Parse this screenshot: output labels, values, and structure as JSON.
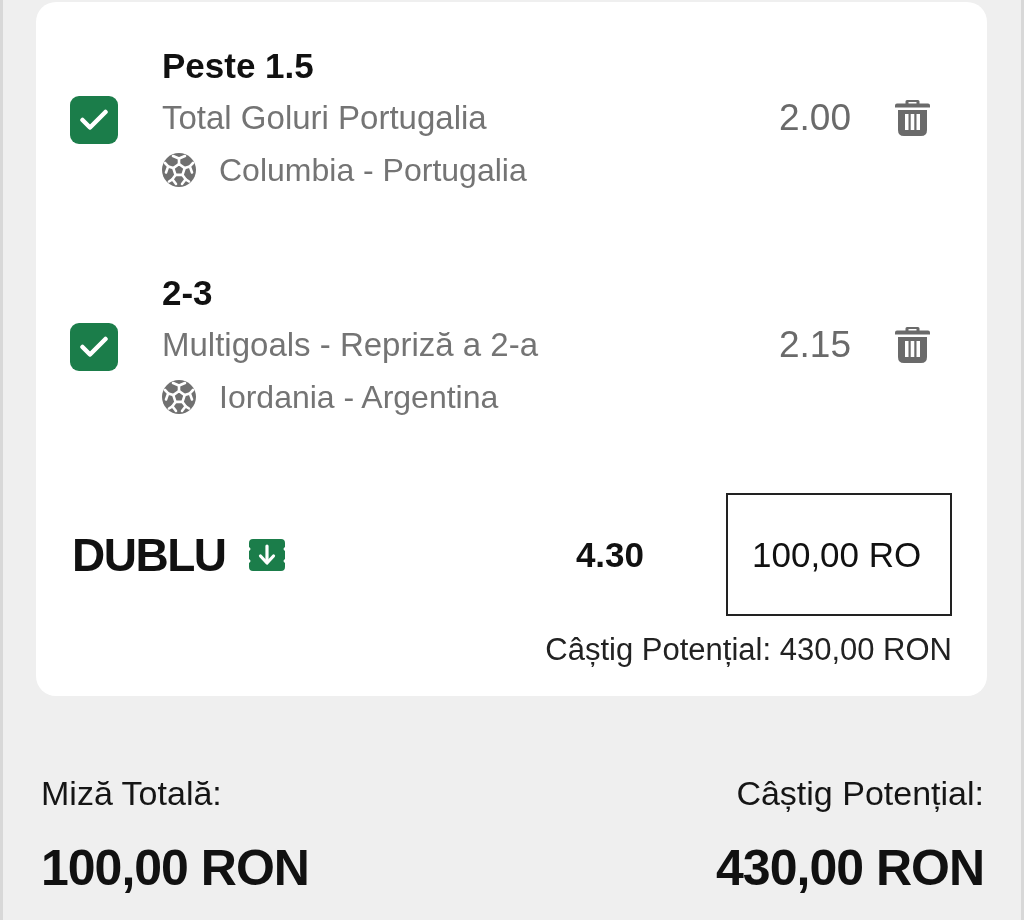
{
  "selections": [
    {
      "pick": "Peste 1.5",
      "market": "Total Goluri Portugalia",
      "event": "Columbia - Portugalia",
      "odds": "2.00",
      "checked": true
    },
    {
      "pick": "2-3",
      "market": "Multigoals - Repriză a 2-a",
      "event": "Iordania - Argentina",
      "odds": "2.15",
      "checked": true
    }
  ],
  "bet": {
    "type": "DUBLU",
    "total_odds": "4.30",
    "stake": {
      "value": "100,00 RO"
    },
    "potential_win": "Câștig Potențial: 430,00 RON"
  },
  "summary": {
    "stake_label": "Miză Totală:",
    "stake_value": "100,00 RON",
    "win_label": "Câștig Potențial:",
    "win_value": "430,00 RON"
  }
}
